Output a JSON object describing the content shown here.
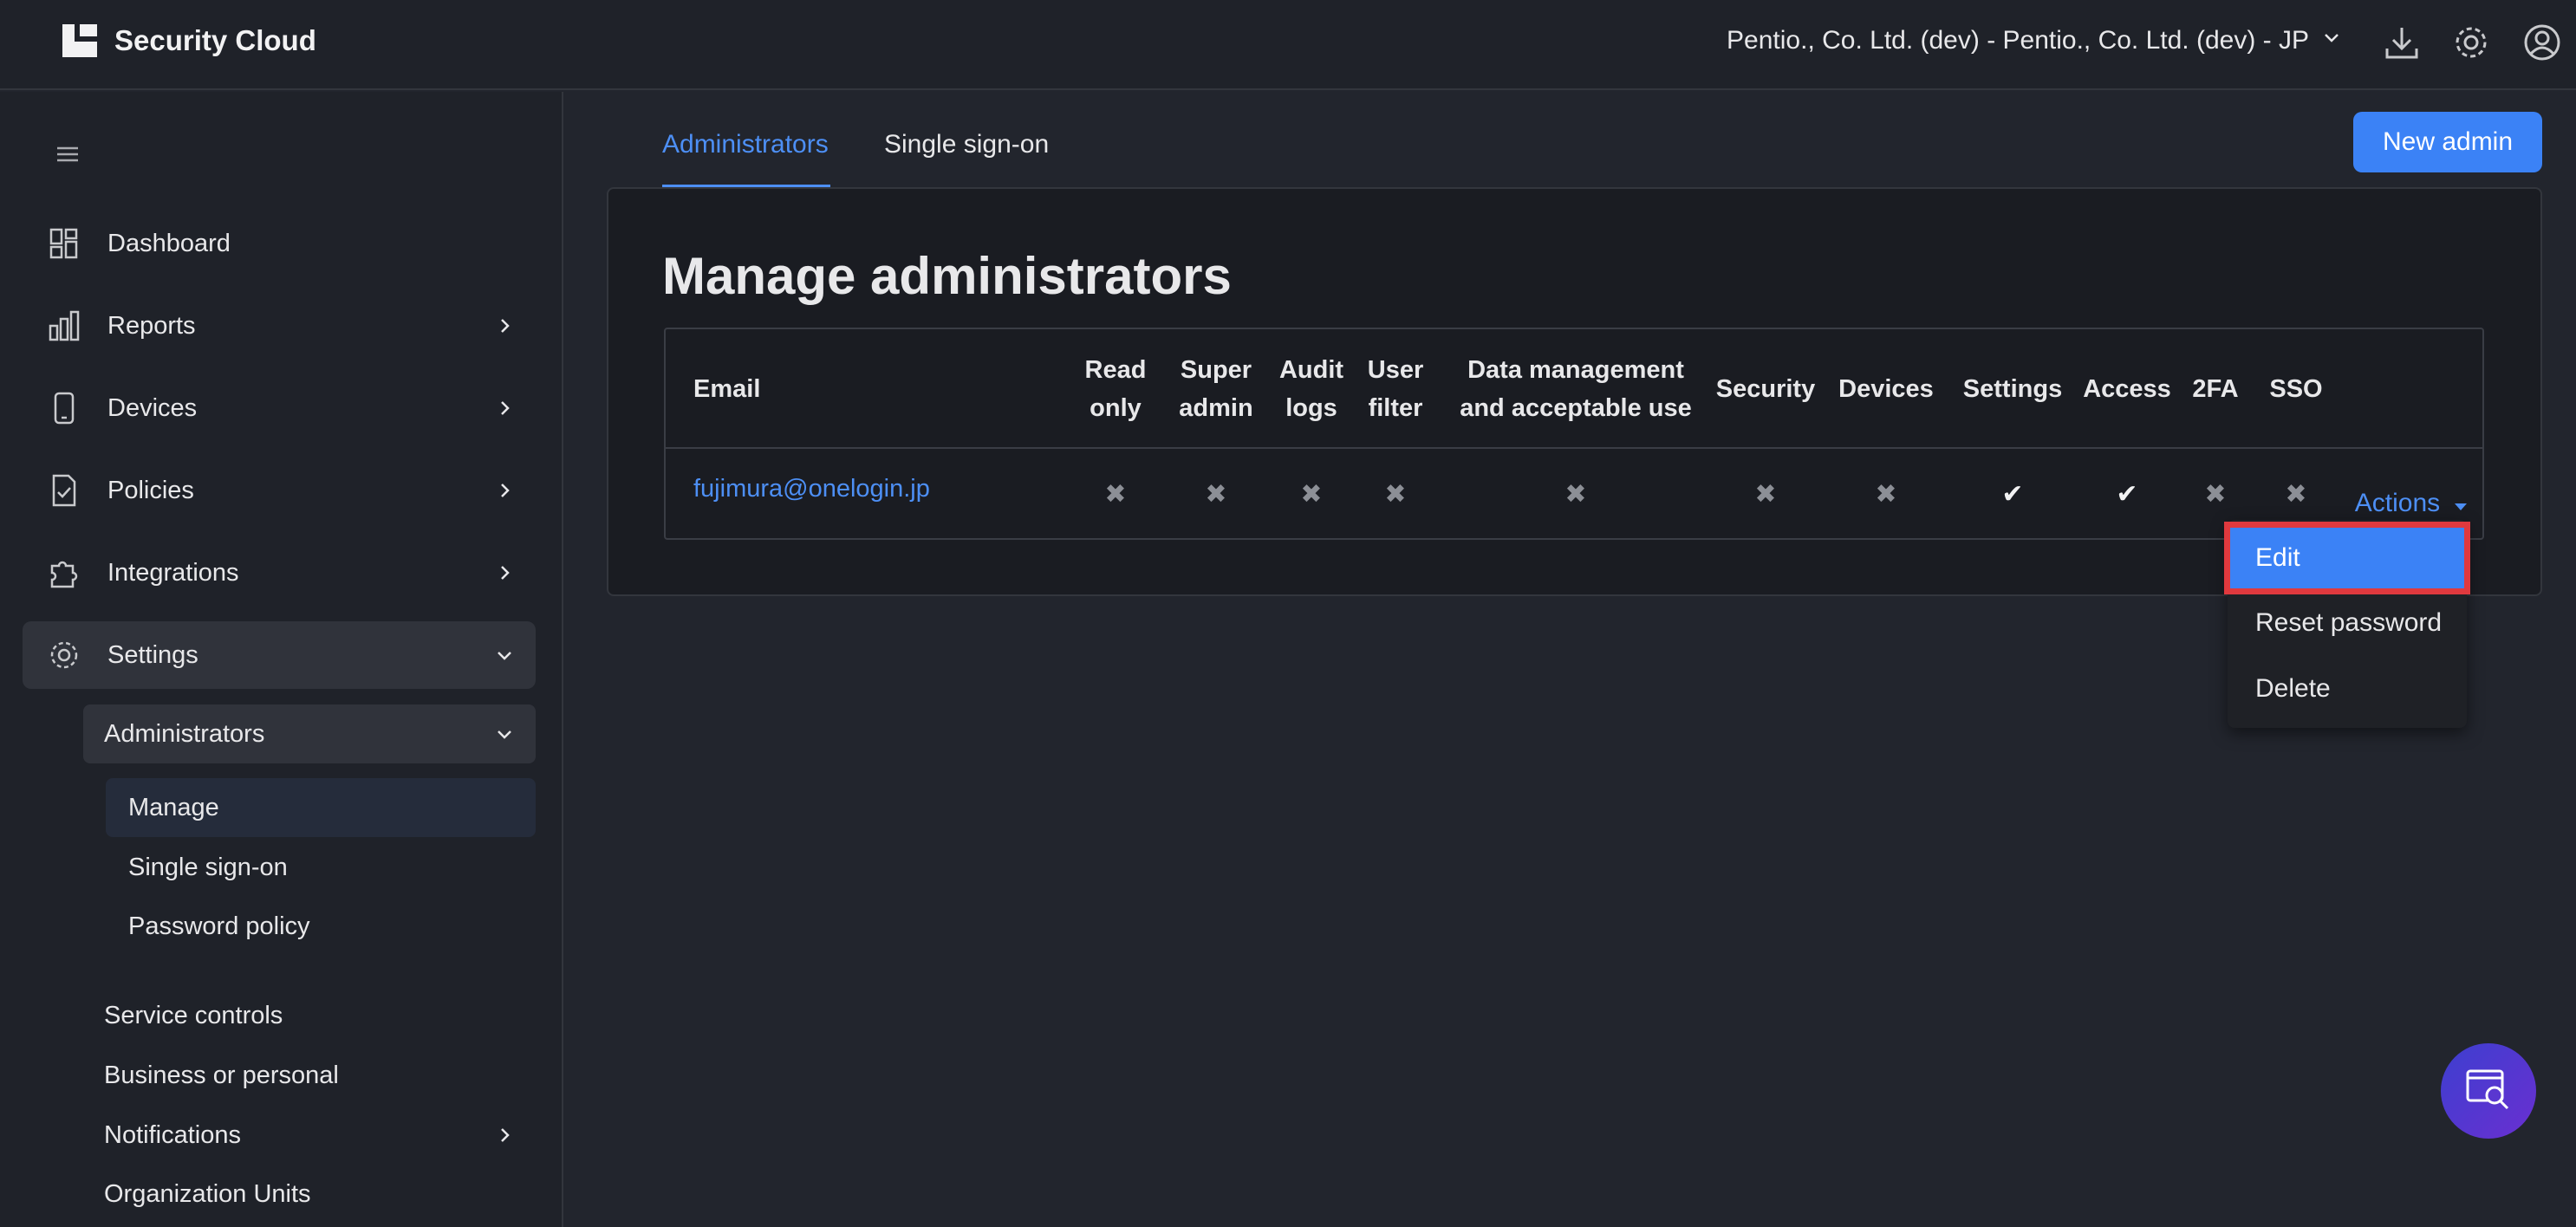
{
  "app": {
    "title": "Security Cloud",
    "org_selector": "Pentio., Co. Ltd. (dev) - Pentio., Co. Ltd. (dev) - JP"
  },
  "sidebar": {
    "items": [
      {
        "label": "Dashboard",
        "icon": "dashboard-icon"
      },
      {
        "label": "Reports",
        "icon": "bar-chart-icon"
      },
      {
        "label": "Devices",
        "icon": "phone-icon"
      },
      {
        "label": "Policies",
        "icon": "document-check-icon"
      },
      {
        "label": "Integrations",
        "icon": "puzzle-icon"
      },
      {
        "label": "Settings",
        "icon": "gear-icon"
      }
    ],
    "settings": {
      "administrators": {
        "label": "Administrators",
        "children": [
          "Manage",
          "Single sign-on",
          "Password policy"
        ]
      },
      "others": [
        "Service controls",
        "Business or personal",
        "Notifications",
        "Organization Units"
      ]
    }
  },
  "tabs": [
    "Administrators",
    "Single sign-on"
  ],
  "new_admin_label": "New admin",
  "page_title": "Manage administrators",
  "table": {
    "headers": {
      "email": "Email",
      "read_only": [
        "Read",
        "only"
      ],
      "super_admin": [
        "Super",
        "admin"
      ],
      "audit_logs": [
        "Audit",
        "logs"
      ],
      "user_filter": [
        "User",
        "filter"
      ],
      "data_mgmt": [
        "Data management",
        "and acceptable use"
      ],
      "security": "Security",
      "devices": "Devices",
      "settings": "Settings",
      "access": "Access",
      "twofa": "2FA",
      "sso": "SSO"
    },
    "row": {
      "email": "fujimura@onelogin.jp",
      "read_only": "✖",
      "super_admin": "✖",
      "audit_logs": "✖",
      "user_filter": "✖",
      "data_mgmt": "✖",
      "security": "✖",
      "devices": "✖",
      "settings": "✔",
      "access": "✔",
      "twofa": "✖",
      "sso": "✖",
      "actions": "Actions"
    }
  },
  "actions_menu": [
    "Edit",
    "Reset password",
    "Delete"
  ],
  "colors": {
    "accent": "#3b82f6",
    "link": "#4d8ff5",
    "highlight": "#e0393e",
    "background": "#22252d"
  }
}
